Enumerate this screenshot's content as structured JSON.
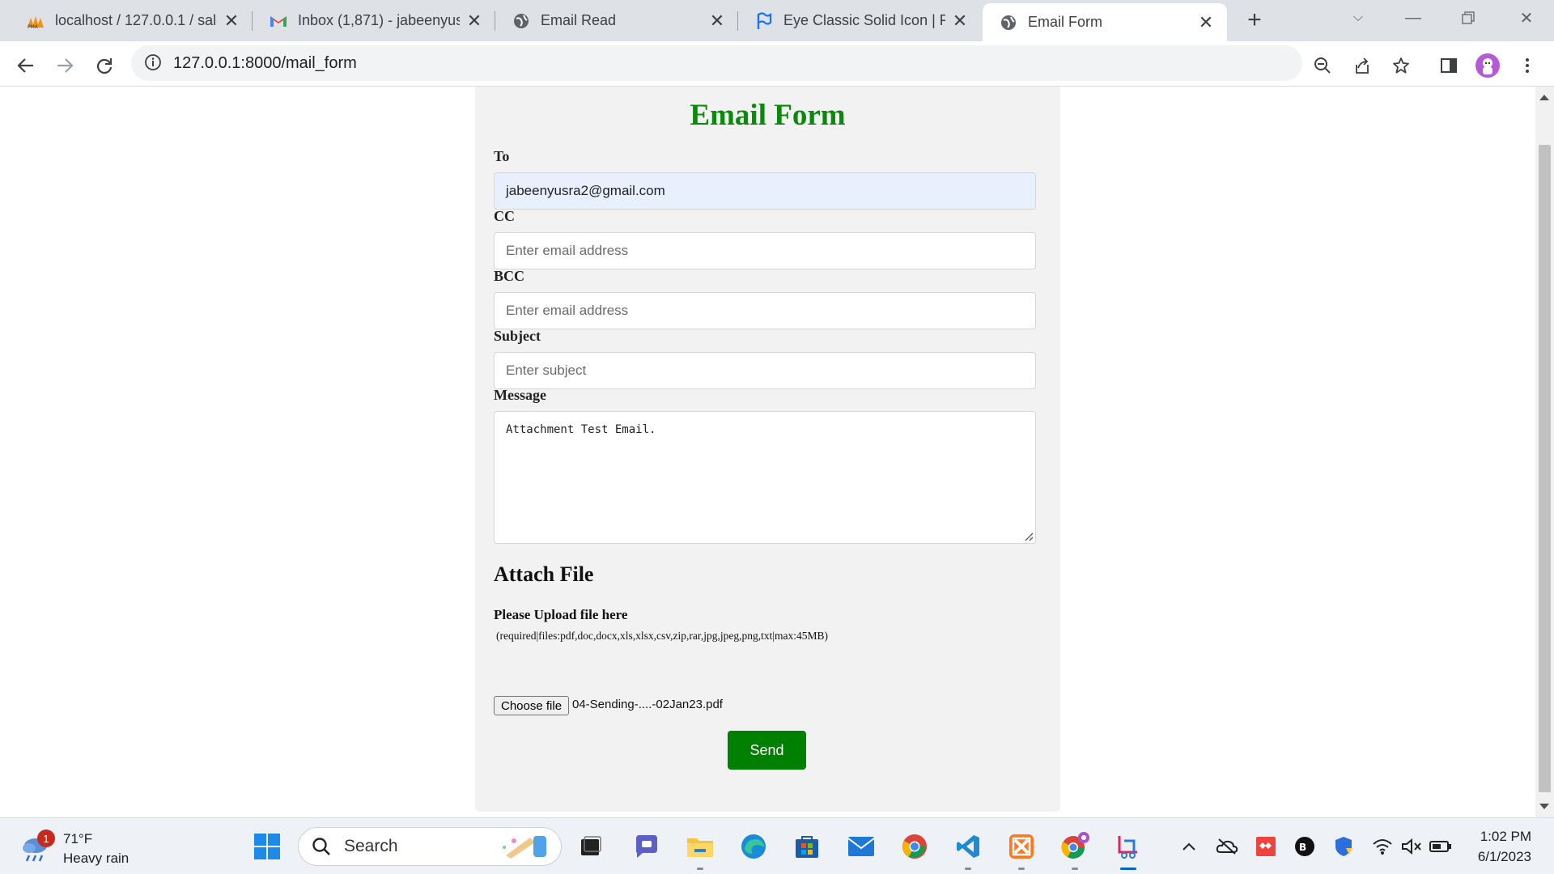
{
  "browser": {
    "tabs": [
      {
        "title": "localhost / 127.0.0.1 / salon",
        "icon": "phpmyadmin-icon",
        "active": false
      },
      {
        "title": "Inbox (1,871) - jabeenyusra2",
        "icon": "gmail-icon",
        "active": false
      },
      {
        "title": "Email Read",
        "icon": "globe-icon",
        "active": false
      },
      {
        "title": "Eye Classic Solid Icon | Font",
        "icon": "flag-icon",
        "active": false
      },
      {
        "title": "Email Form",
        "icon": "globe-icon",
        "active": true
      }
    ],
    "url": "127.0.0.1:8000/mail_form"
  },
  "page": {
    "title": "Email Form",
    "to": {
      "label": "To",
      "value": "jabeenyusra2@gmail.com"
    },
    "cc": {
      "label": "CC",
      "placeholder": "Enter email address"
    },
    "bcc": {
      "label": "BCC",
      "placeholder": "Enter email address"
    },
    "subject": {
      "label": "Subject",
      "placeholder": "Enter subject"
    },
    "message": {
      "label": "Message",
      "value": "Attachment Test Email."
    },
    "attach": {
      "heading": "Attach File",
      "upload_label": "Please Upload file here",
      "hint": "(required|files:pdf,doc,docx,xls,xlsx,csv,zip,rar,jpg,jpeg,png,txt|max:45MB)",
      "choose_label": "Choose file",
      "chosen_file": "04-Sending-....-02Jan23.pdf"
    },
    "send_label": "Send",
    "colors": {
      "title": "#0a8a0a",
      "send": "#008000",
      "card": "#f2f2f2"
    }
  },
  "taskbar": {
    "weather_temp": "71°F",
    "weather_desc": "Heavy rain",
    "weather_badge": "1",
    "search_label": "Search",
    "time": "1:02 PM",
    "date": "6/1/2023"
  }
}
